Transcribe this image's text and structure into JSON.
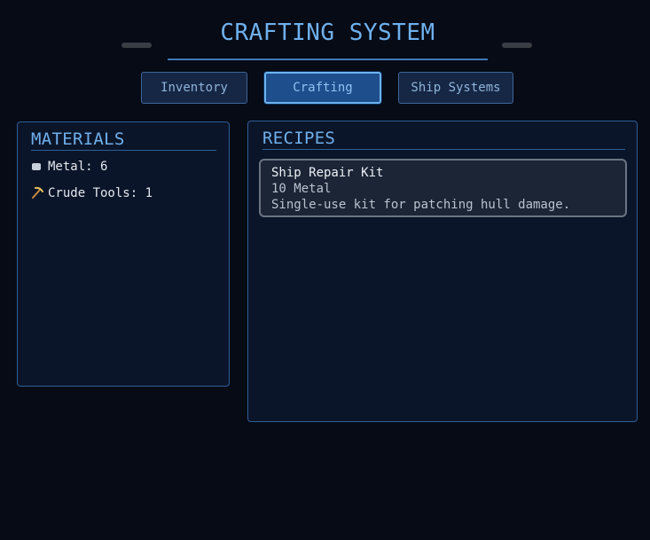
{
  "title": "CRAFTING SYSTEM",
  "tabs": [
    {
      "label": "Inventory",
      "active": false
    },
    {
      "label": "Crafting",
      "active": true
    },
    {
      "label": "Ship Systems",
      "active": false
    }
  ],
  "materials": {
    "header": "MATERIALS",
    "items": [
      {
        "icon": "metal-block-icon",
        "label": "Metal: 6"
      },
      {
        "icon": "pickaxe-icon",
        "label": "Crude Tools: 1"
      }
    ]
  },
  "recipes": {
    "header": "RECIPES",
    "items": [
      {
        "name": "Ship Repair Kit",
        "cost": "10 Metal",
        "description": "Single-use kit for patching hull damage."
      }
    ]
  },
  "colors": {
    "background": "#060b16",
    "accent": "#6fb0ec",
    "panel_border": "#2d5e98",
    "active_tab": "#1f4e8c"
  }
}
